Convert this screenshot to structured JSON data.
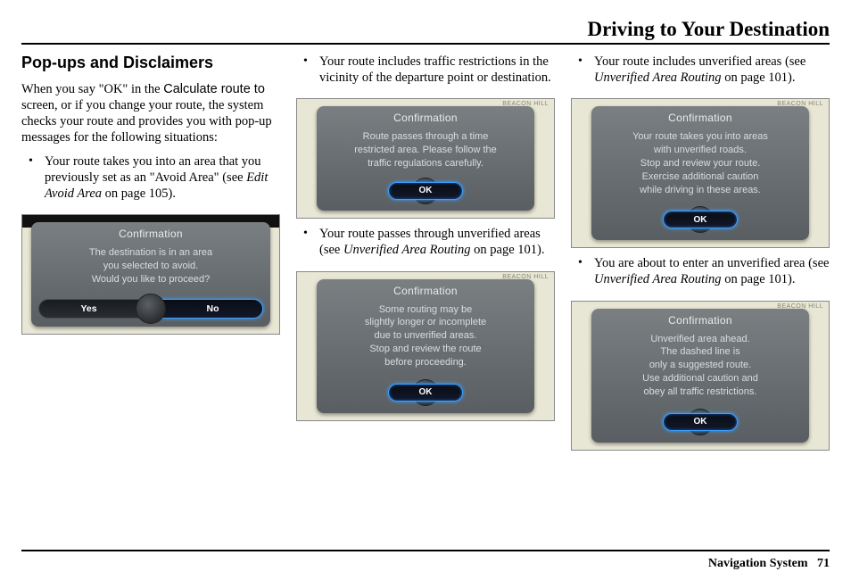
{
  "header": {
    "title": "Driving to Your Destination"
  },
  "section": {
    "title": "Pop-ups and Disclaimers"
  },
  "intro": {
    "pre": "When you say \"OK\" in the ",
    "sans": "Calculate route to",
    "post": " screen, or if you change your route, the system checks your route and provides you with pop-up messages for the following situations:"
  },
  "col1": {
    "bullet1a": "Your route takes you into an area that you previously set as an \"Avoid Area\" (see ",
    "bullet1b": "Edit Avoid Area",
    "bullet1c": " on page 105).",
    "dlg": {
      "title": "Confirmation",
      "body": "The destination is in an area\nyou selected to avoid.\nWould you like to proceed?",
      "yes": "Yes",
      "no": "No"
    }
  },
  "col2": {
    "bullet1": "Your route includes traffic restrictions in the vicinity of the departure point or destination.",
    "dlg1": {
      "title": "Confirmation",
      "body": "Route passes through a time\nrestricted area. Please follow the\ntraffic regulations carefully.",
      "ok": "OK"
    },
    "bullet2a": "Your route passes through unverified areas (see ",
    "bullet2b": "Unverified Area Routing",
    "bullet2c": " on page 101).",
    "dlg2": {
      "title": "Confirmation",
      "body": "Some routing may be\nslightly longer or incomplete\ndue to unverified areas.\nStop and review the route\nbefore proceeding.",
      "ok": "OK"
    }
  },
  "col3": {
    "bullet1a": "Your route includes unverified areas (see ",
    "bullet1b": "Unverified Area Routing",
    "bullet1c": " on page 101).",
    "dlg1": {
      "title": "Confirmation",
      "body": "Your route takes you into areas\nwith unverified roads.\nStop and review your route.\nExercise additional caution\nwhile driving in these areas.",
      "ok": "OK"
    },
    "bullet2a": "You are about to enter an unverified area (see ",
    "bullet2b": "Unverified Area Routing",
    "bullet2c": " on page 101).",
    "dlg2": {
      "title": "Confirmation",
      "body": "Unverified area ahead.\nThe dashed line is\nonly a suggested route.\nUse additional caution and\nobey all traffic restrictions.",
      "ok": "OK"
    }
  },
  "maplabel": "BEACON HILL",
  "footer": {
    "label": "Navigation System",
    "page": "71"
  }
}
